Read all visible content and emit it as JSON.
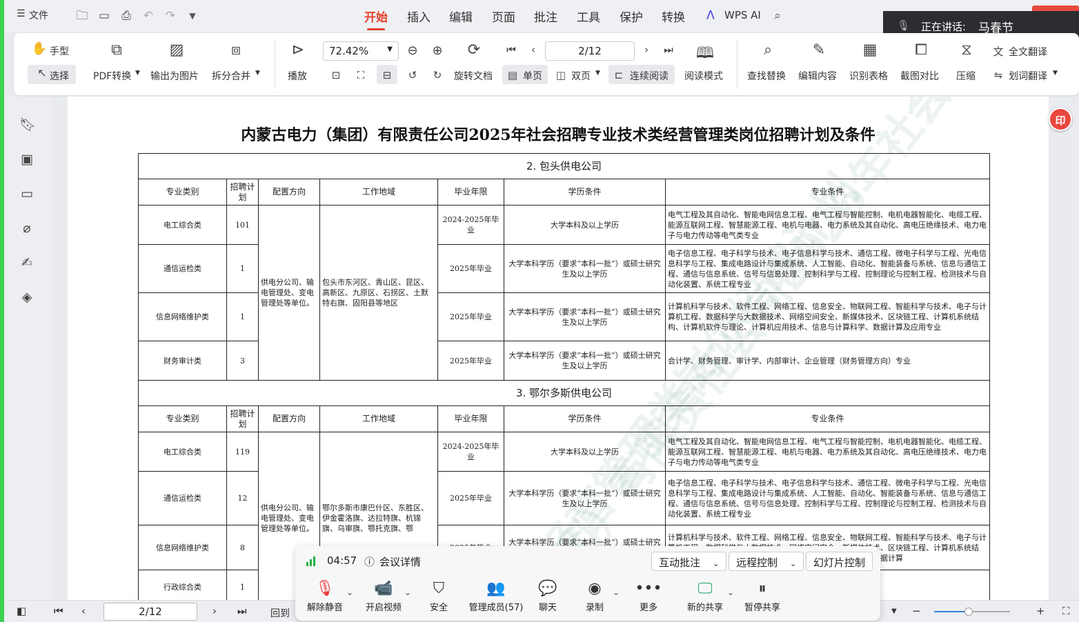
{
  "app": {
    "file_menu": "文件",
    "tabs": [
      "开始",
      "插入",
      "编辑",
      "页面",
      "批注",
      "工具",
      "保护",
      "转换"
    ],
    "active_tab": "开始",
    "ai_label": "WPS AI"
  },
  "speaking": {
    "label": "正在讲话:",
    "name": "马春节"
  },
  "ribbon": {
    "hand": "手型",
    "select": "选择",
    "pdf_convert": "PDF转换",
    "export_image": "输出为图片",
    "split_merge": "拆分合并",
    "play": "播放",
    "zoom": "72.42%",
    "rotate_doc": "旋转文档",
    "page_indicator": "2/12",
    "single": "单页",
    "double": "双页",
    "continuous": "连续阅读",
    "read_mode": "阅读模式",
    "find_replace": "查找替换",
    "edit_content": "编辑内容",
    "recognize_table": "识别表格",
    "screenshot_compare": "截图对比",
    "compress": "压缩",
    "full_translate": "全文翻译",
    "word_translate": "划词翻译"
  },
  "document": {
    "title": "内蒙古电力（集团）有限责任公司2025年社会招聘专业技术类经营管理类岗位招聘计划及条件",
    "headers": [
      "专业类别",
      "招聘计划",
      "配置方向",
      "工作地域",
      "毕业年限",
      "学历条件",
      "专业条件"
    ],
    "sections": [
      {
        "name": "2. 包头供电公司",
        "direction": "供电分公司、输电管理处、变电管理处等单位。",
        "region": "包头市东河区、青山区、昆区、高新区、九原区、石拐区、土默特右旗、固阳县等地区",
        "rows": [
          {
            "category": "电工综合类",
            "count": "101",
            "year": "2024-2025年毕业",
            "edu": "大学本科及以上学历",
            "major": "电气工程及其自动化、智能电网信息工程、电气工程与智能控制、电机电器智能化、电缆工程、能源互联网工程、智慧能源工程、电机与电器、电力系统及其自动化、高电压绝缘技术、电力电子与电力传动等电气类专业"
          },
          {
            "category": "通信运检类",
            "count": "1",
            "year": "2025年毕业",
            "edu": "大学本科学历（要求“本科一批”）或硕士研究生及以上学历",
            "major": "电子信息工程、电子科学与技术、电子信息科学与技术、通信工程、微电子科学与工程、光电信息科学与工程、集成电路设计与集成系统、人工智能、自动化、智能装备与系统、信息与通信工程、通信与信息系统、信号与信息处理、控制科学与工程、控制理论与控制工程、检测技术与自动化装置、系统工程专业"
          },
          {
            "category": "信息网络维护类",
            "count": "1",
            "year": "2025年毕业",
            "edu": "大学本科学历（要求“本科一批”）或硕士研究生及以上学历",
            "major": "计算机科学与技术、软件工程、网络工程、信息安全、物联网工程、智能科学与技术、电子与计算机工程、数据科学与大数据技术、网络空间安全、新媒体技术、区块链工程、计算机系统结构、计算机软件与理论、计算机应用技术、信息与计算科学、数据计算及应用专业"
          },
          {
            "category": "财务审计类",
            "count": "3",
            "year": "2025年毕业",
            "edu": "大学本科学历（要求“本科一批”）或硕士研究生及以上学历",
            "major": "会计学、财务管理、审计学、内部审计、企业管理（财务管理方向）专业"
          }
        ]
      },
      {
        "name": "3. 鄂尔多斯供电公司",
        "direction": "供电分公司、输电管理处、变电管理处等单位。",
        "region": "鄂尔多斯市康巴什区、东胜区、伊金霍洛旗、达拉特旗、杭锦旗、乌审旗、鄂托克旗、鄂",
        "rows": [
          {
            "category": "电工综合类",
            "count": "119",
            "year": "2024-2025年毕业",
            "edu": "大学本科及以上学历",
            "major": "电气工程及其自动化、智能电网信息工程、电气工程与智能控制、电机电器智能化、电缆工程、能源互联网工程、智慧能源工程、电机与电器、电力系统及其自动化、高电压绝缘技术、电力电子与电力传动等电气类专业"
          },
          {
            "category": "通信运检类",
            "count": "12",
            "year": "2025年毕业",
            "edu": "大学本科学历（要求“本科一批”）或硕士研究生及以上学历",
            "major": "电子信息工程、电子科学与技术、电子信息科学与技术、通信工程、微电子科学与工程、光电信息科学与工程、集成电路设计与集成系统、人工智能、自动化、智能装备与系统、信息与通信工程、通信与信息系统、信号与信息处理、控制科学与工程、控制理论与控制工程、检测技术与自动化装置、系统工程专业"
          },
          {
            "category": "信息网络维护类",
            "count": "8",
            "year": "2025年毕业",
            "edu": "大学本科学历（要求“本科一批”）或硕士研究生及以上学历",
            "major": "计算机科学与技术、软件工程、网络工程、信息安全、物联网工程、智能科学与技术、电子与计算机工程、数据科学与大数据技术、网络空间安全、新媒体技术、区块链工程、计算机系统结构、计算机软件与理论、计算机应用技术、信息与计算科学、数据计算"
          },
          {
            "category": "行政综合类",
            "count": "1",
            "year": "",
            "edu": "",
            "major": "史学类、哲学类、政治学类专"
          }
        ]
      }
    ]
  },
  "statusbar": {
    "page": "2/12",
    "goto": "回到"
  },
  "meeting": {
    "time": "04:57",
    "details": "会议详情",
    "btn_annotate": "互动批注",
    "btn_remote": "远程控制",
    "btn_slides": "幻灯片控制",
    "controls": [
      "解除静音",
      "开启视频",
      "安全",
      "管理成员(57)",
      "聊天",
      "录制",
      "更多",
      "新的共享",
      "暂停共享"
    ]
  },
  "badge": "印"
}
